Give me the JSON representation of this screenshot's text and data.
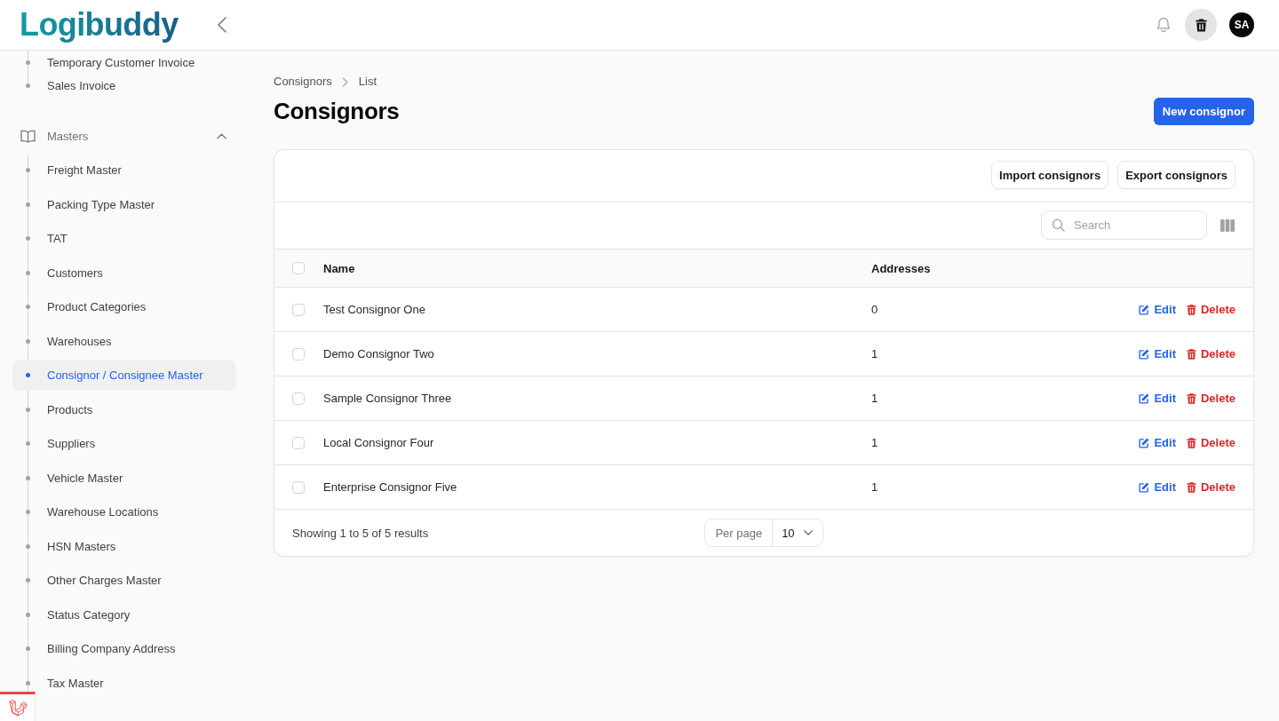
{
  "header": {
    "logo": "Logibuddy",
    "avatar": "SA"
  },
  "sidebar": {
    "items": [
      {
        "label": "Temporary Customer Invoice",
        "selected": false
      },
      {
        "label": "Sales Invoice",
        "selected": false
      }
    ],
    "groups": [
      {
        "label": "Masters",
        "expanded": true,
        "items": [
          {
            "label": "Freight Master",
            "selected": false
          },
          {
            "label": "Packing Type Master",
            "selected": false
          },
          {
            "label": "TAT",
            "selected": false
          },
          {
            "label": "Customers",
            "selected": false
          },
          {
            "label": "Product Categories",
            "selected": false
          },
          {
            "label": "Warehouses",
            "selected": false
          },
          {
            "label": "Consignor / Consignee Master",
            "selected": true
          },
          {
            "label": "Products",
            "selected": false
          },
          {
            "label": "Suppliers",
            "selected": false
          },
          {
            "label": "Vehicle Master",
            "selected": false
          },
          {
            "label": "Warehouse Locations",
            "selected": false
          },
          {
            "label": "HSN Masters",
            "selected": false
          },
          {
            "label": "Other Charges Master",
            "selected": false
          },
          {
            "label": "Status Category",
            "selected": false
          },
          {
            "label": "Billing Company Address",
            "selected": false
          },
          {
            "label": "Tax Master",
            "selected": false
          }
        ]
      }
    ]
  },
  "page": {
    "breadcrumbs": [
      "Consignors",
      "List"
    ],
    "title": "Consignors",
    "primary_action": "New consignor"
  },
  "table": {
    "header_actions": [
      "Import consignors",
      "Export consignors"
    ],
    "search": {
      "placeholder": "Search"
    },
    "select_all": {
      "checked": false
    },
    "columns": [
      "Name",
      "Addresses"
    ],
    "rows": [
      {
        "checked": false,
        "cells": [
          "Test Consignor One",
          "0"
        ],
        "actions": [
          {
            "kind": "edit",
            "label": "Edit"
          },
          {
            "kind": "delete",
            "label": "Delete"
          }
        ]
      },
      {
        "checked": false,
        "cells": [
          "Demo Consignor Two",
          "1"
        ],
        "actions": [
          {
            "kind": "edit",
            "label": "Edit"
          },
          {
            "kind": "delete",
            "label": "Delete"
          }
        ]
      },
      {
        "checked": false,
        "cells": [
          "Sample Consignor Three",
          "1"
        ],
        "actions": [
          {
            "kind": "edit",
            "label": "Edit"
          },
          {
            "kind": "delete",
            "label": "Delete"
          }
        ]
      },
      {
        "checked": false,
        "cells": [
          "Local Consignor Four",
          "1"
        ],
        "actions": [
          {
            "kind": "edit",
            "label": "Edit"
          },
          {
            "kind": "delete",
            "label": "Delete"
          }
        ]
      },
      {
        "checked": false,
        "cells": [
          "Enterprise Consignor Five",
          "1"
        ],
        "actions": [
          {
            "kind": "edit",
            "label": "Edit"
          },
          {
            "kind": "delete",
            "label": "Delete"
          }
        ]
      }
    ],
    "footer": {
      "summary": "Showing 1 to 5 of 5 results",
      "per_page_label": "Per page",
      "per_page": "10"
    }
  }
}
